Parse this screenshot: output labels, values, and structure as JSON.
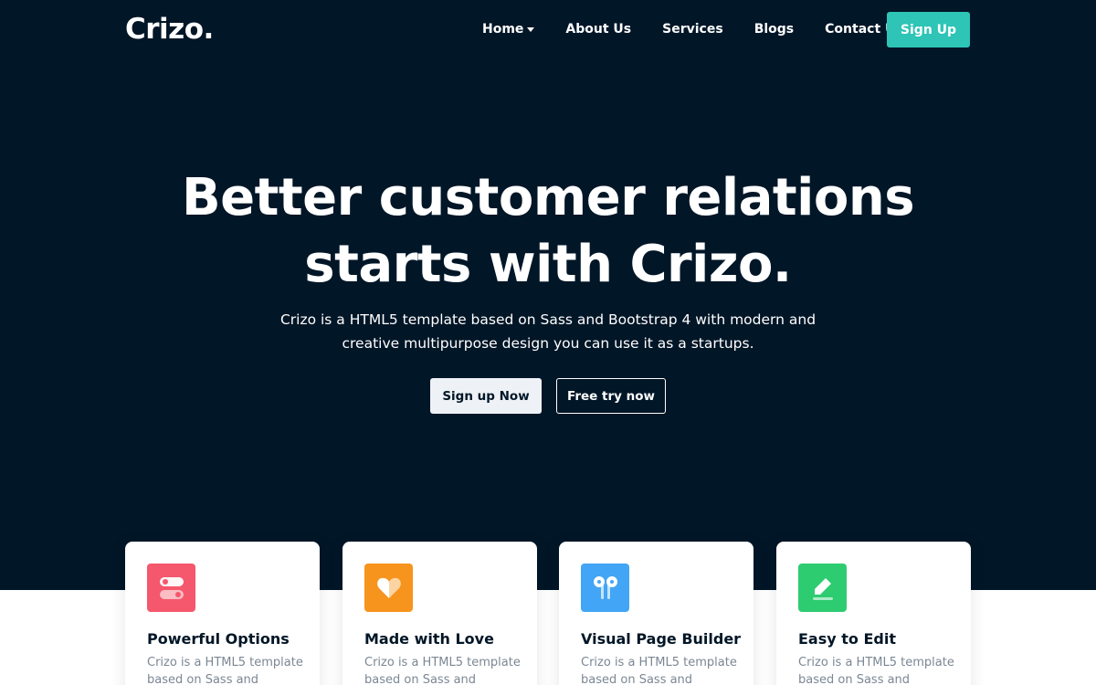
{
  "brand": {
    "logo": "Crizo."
  },
  "nav": {
    "items": [
      "Home",
      "About Us",
      "Services",
      "Blogs",
      "Contact Us"
    ],
    "signup_label": "Sign Up"
  },
  "hero": {
    "headline_line1": "Better customer relations",
    "headline_line2": "starts with Crizo.",
    "subtitle_line1": "Crizo is a HTML5 template based on Sass and Bootstrap 4 with modern and",
    "subtitle_line2": "creative multipurpose design you can use it as a startups.",
    "primary_cta": "Sign up Now",
    "secondary_cta": "Free try now"
  },
  "features": [
    {
      "title": "Powerful Options",
      "text": "Crizo is a HTML5 template based on Sass and",
      "icon": "toggle-icon",
      "color": "#f5576c"
    },
    {
      "title": "Made with Love",
      "text": "Crizo is a HTML5 template based on Sass and",
      "icon": "heart-icon",
      "color": "#f7941d"
    },
    {
      "title": "Visual Page Builder",
      "text": "Crizo is a HTML5 template based on Sass and",
      "icon": "earbuds-icon",
      "color": "#42a5f5"
    },
    {
      "title": "Easy to Edit",
      "text": "Crizo is a HTML5 template based on Sass and",
      "icon": "pencil-icon",
      "color": "#2ecc71"
    }
  ],
  "colors": {
    "hero_bg": "#011627",
    "accent": "#2ec4b6"
  }
}
